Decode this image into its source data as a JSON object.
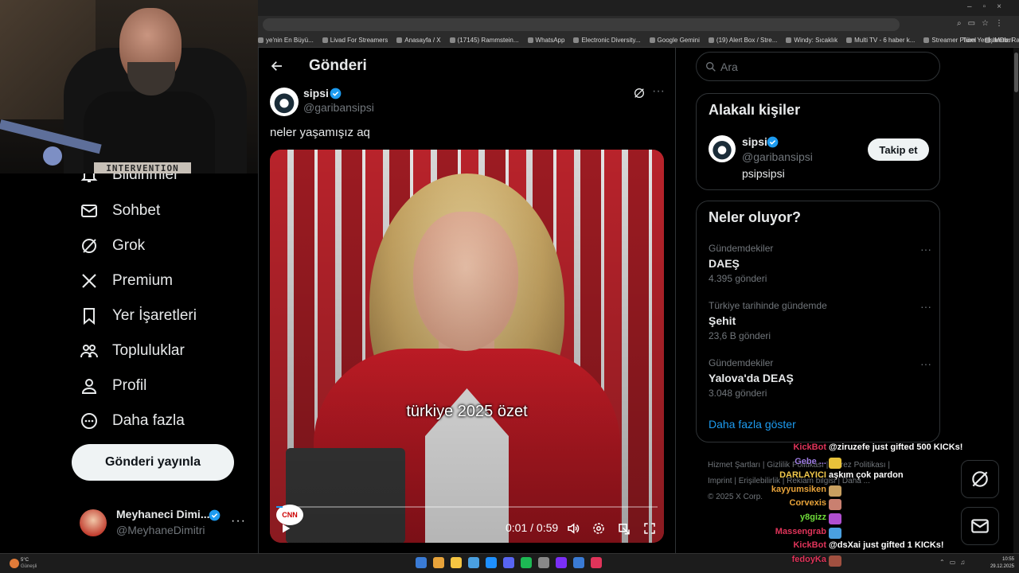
{
  "webcam": {
    "sticker_text": "INTERVENTION"
  },
  "bookmarks": [
    "ye'nin En Büyü...",
    "Livad For Streamers",
    "Anasayfa / X",
    "(17145) Rammstein...",
    "WhatsApp",
    "Electronic Diversity...",
    "Google Gemini",
    "(19) Alert Box / Stre...",
    "Windy: Sıcaklık",
    "Multi TV - 6 haber k...",
    "Streamer Panel",
    "IMDb: Ratings, Revi...",
    "Ana Sayfa • HBO Max"
  ],
  "bookmarks_more": "»",
  "bookmarks_all": "Tüm Yer İşaretleri",
  "nav": {
    "items": [
      {
        "label": "Bildirimler",
        "icon": "bell-icon"
      },
      {
        "label": "Sohbet",
        "icon": "mail-icon"
      },
      {
        "label": "Grok",
        "icon": "grok-icon"
      },
      {
        "label": "Premium",
        "icon": "x-logo-icon"
      },
      {
        "label": "Yer İşaretleri",
        "icon": "bookmark-icon"
      },
      {
        "label": "Topluluklar",
        "icon": "communities-icon"
      },
      {
        "label": "Profil",
        "icon": "profile-icon"
      },
      {
        "label": "Daha fazla",
        "icon": "more-circle-icon"
      }
    ],
    "post_button": "Gönderi yayınla",
    "profile": {
      "name": "Meyhaneci Dimi...",
      "handle": "@MeyhaneDimitri",
      "more": "···"
    }
  },
  "main": {
    "title": "Gönderi",
    "tweet": {
      "name": "sipsi",
      "handle": "@garibansipsi",
      "text": "neler yaşamışız aq",
      "more": "···"
    },
    "video": {
      "caption": "türkiye 2025 özet",
      "logo": "CNN",
      "time": "0:01 / 0:59",
      "progress": 0.017
    }
  },
  "sidebar": {
    "search_placeholder": "Ara",
    "related": {
      "title": "Alakalı kişiler",
      "name": "sipsi",
      "handle": "@garibansipsi",
      "bio": "psipsipsi",
      "follow": "Takip et"
    },
    "trends": {
      "title": "Neler oluyor?",
      "items": [
        {
          "context": "Gündemdekiler",
          "topic": "DAEŞ",
          "count": "4.395 gönderi"
        },
        {
          "context": "Türkiye tarihinde gündemde",
          "topic": "Şehit",
          "count": "23,6 B gönderi"
        },
        {
          "context": "Gündemdekiler",
          "topic": "Yalova'da DEAŞ",
          "count": "3.048 gönderi"
        }
      ],
      "show_more": "Daha fazla göster",
      "dots": "···"
    },
    "footer": {
      "line1": "Hizmet Şartları  |  Gizlilik Politikası  |  Çerez Politikası  |",
      "line2": "Imprint  |  Erişilebilirlik  |  Reklam bilgisi  |  Daha ...",
      "line3": "© 2025 X Corp."
    }
  },
  "chat": [
    {
      "user": "KickBot",
      "color": "#e0345a",
      "message": "@ziruzefe just gifted 500 KICKs!"
    },
    {
      "user": "Gebe ...",
      "color": "#9c7be0",
      "message": "",
      "emote": "#e8c23a"
    },
    {
      "user": "DARLAYICI",
      "color": "#f2c94c",
      "message": "aşkım çok pardon"
    },
    {
      "user": "kayyumsiken",
      "color": "#e8a33a",
      "message": "",
      "emote": "#c9a060"
    },
    {
      "user": "Corvexis",
      "color": "#e8a33a",
      "message": "",
      "emote": "#c98070"
    },
    {
      "user": "y8gizz",
      "color": "#6fdc3a",
      "message": "",
      "emote": "#b04fd0"
    },
    {
      "user": "Massengrab",
      "color": "#e0345a",
      "message": "",
      "emote": "#4aa0e0"
    },
    {
      "user": "KickBot",
      "color": "#e0345a",
      "message": "@dsXai just gifted 1 KICKs!"
    },
    {
      "user": "fedoyKa",
      "color": "#e0345a",
      "message": "",
      "emote": "#a05040"
    }
  ],
  "taskbar": {
    "weather_temp": "5°C",
    "weather_text": "Güneşli",
    "time": "10:55",
    "date": "29.12.2025",
    "app_colors": [
      "#3a7bd5",
      "#e8a33a",
      "#f5c542",
      "#4aa0e0",
      "#1e90ff",
      "#5865f2",
      "#1db954",
      "#888888",
      "#7b2ff7",
      "#3a7bd5",
      "#e0345a"
    ]
  },
  "colors": {
    "accent": "#1d9bf0",
    "verified": "#1d9bf0"
  }
}
